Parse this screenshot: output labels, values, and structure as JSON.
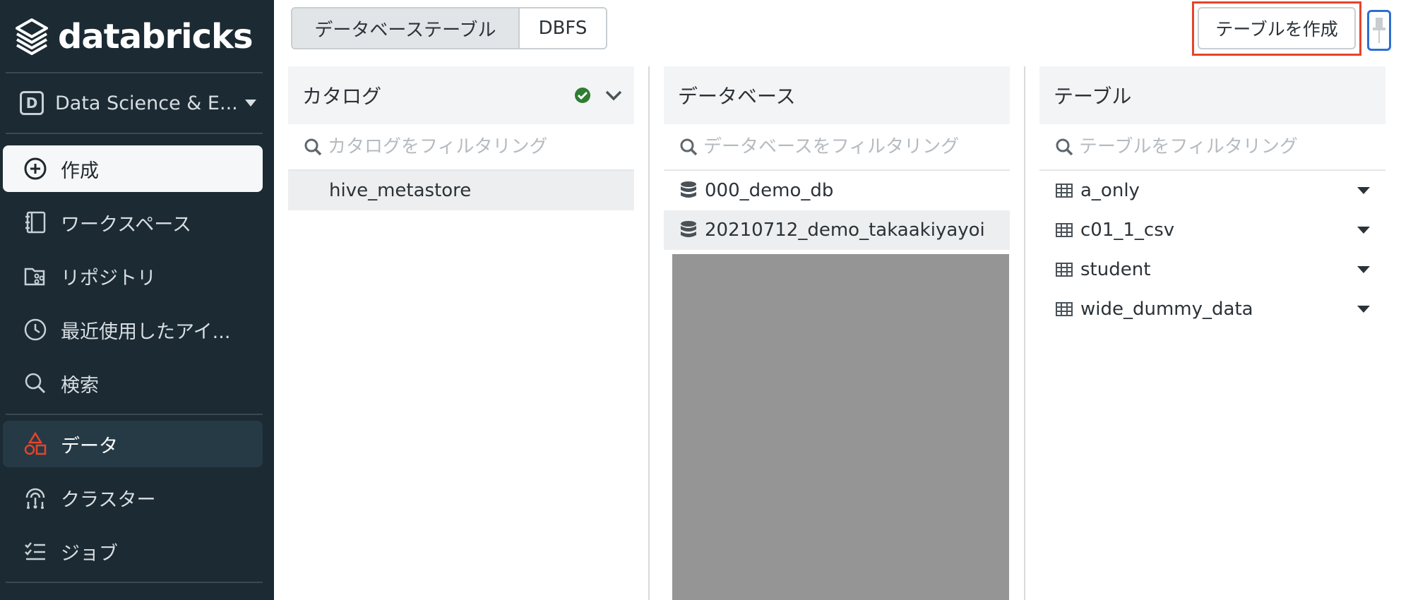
{
  "brand": {
    "name": "databricks"
  },
  "sidebar": {
    "workspace": {
      "badge": "D",
      "label": "Data Science & E..."
    },
    "items": [
      {
        "label": "作成",
        "icon": "plus-circle-icon"
      },
      {
        "label": "ワークスペース",
        "icon": "notebook-icon"
      },
      {
        "label": "リポジトリ",
        "icon": "repo-icon"
      },
      {
        "label": "最近使用したアイ...",
        "icon": "clock-icon"
      },
      {
        "label": "検索",
        "icon": "search-icon"
      },
      {
        "label": "データ",
        "icon": "data-shapes-icon"
      },
      {
        "label": "クラスター",
        "icon": "cluster-icon"
      },
      {
        "label": "ジョブ",
        "icon": "jobs-icon"
      }
    ],
    "accent": "#e6442a"
  },
  "toolbar": {
    "tabs": [
      "データベーステーブル",
      "DBFS"
    ],
    "selected_tab": "データベーステーブル",
    "create_table_label": "テーブルを作成",
    "highlight_color": "#e6442a"
  },
  "catalog": {
    "header": "カタログ",
    "filter_placeholder": "カタログをフィルタリング",
    "items": [
      "hive_metastore"
    ],
    "selected": "hive_metastore"
  },
  "database": {
    "header": "データベース",
    "filter_placeholder": "データベースをフィルタリング",
    "items": [
      "000_demo_db",
      "20210712_demo_takaakiyayoi"
    ],
    "selected": "20210712_demo_takaakiyayoi"
  },
  "tables": {
    "header": "テーブル",
    "filter_placeholder": "テーブルをフィルタリング",
    "items": [
      "a_only",
      "c01_1_csv",
      "student",
      "wide_dummy_data"
    ]
  }
}
